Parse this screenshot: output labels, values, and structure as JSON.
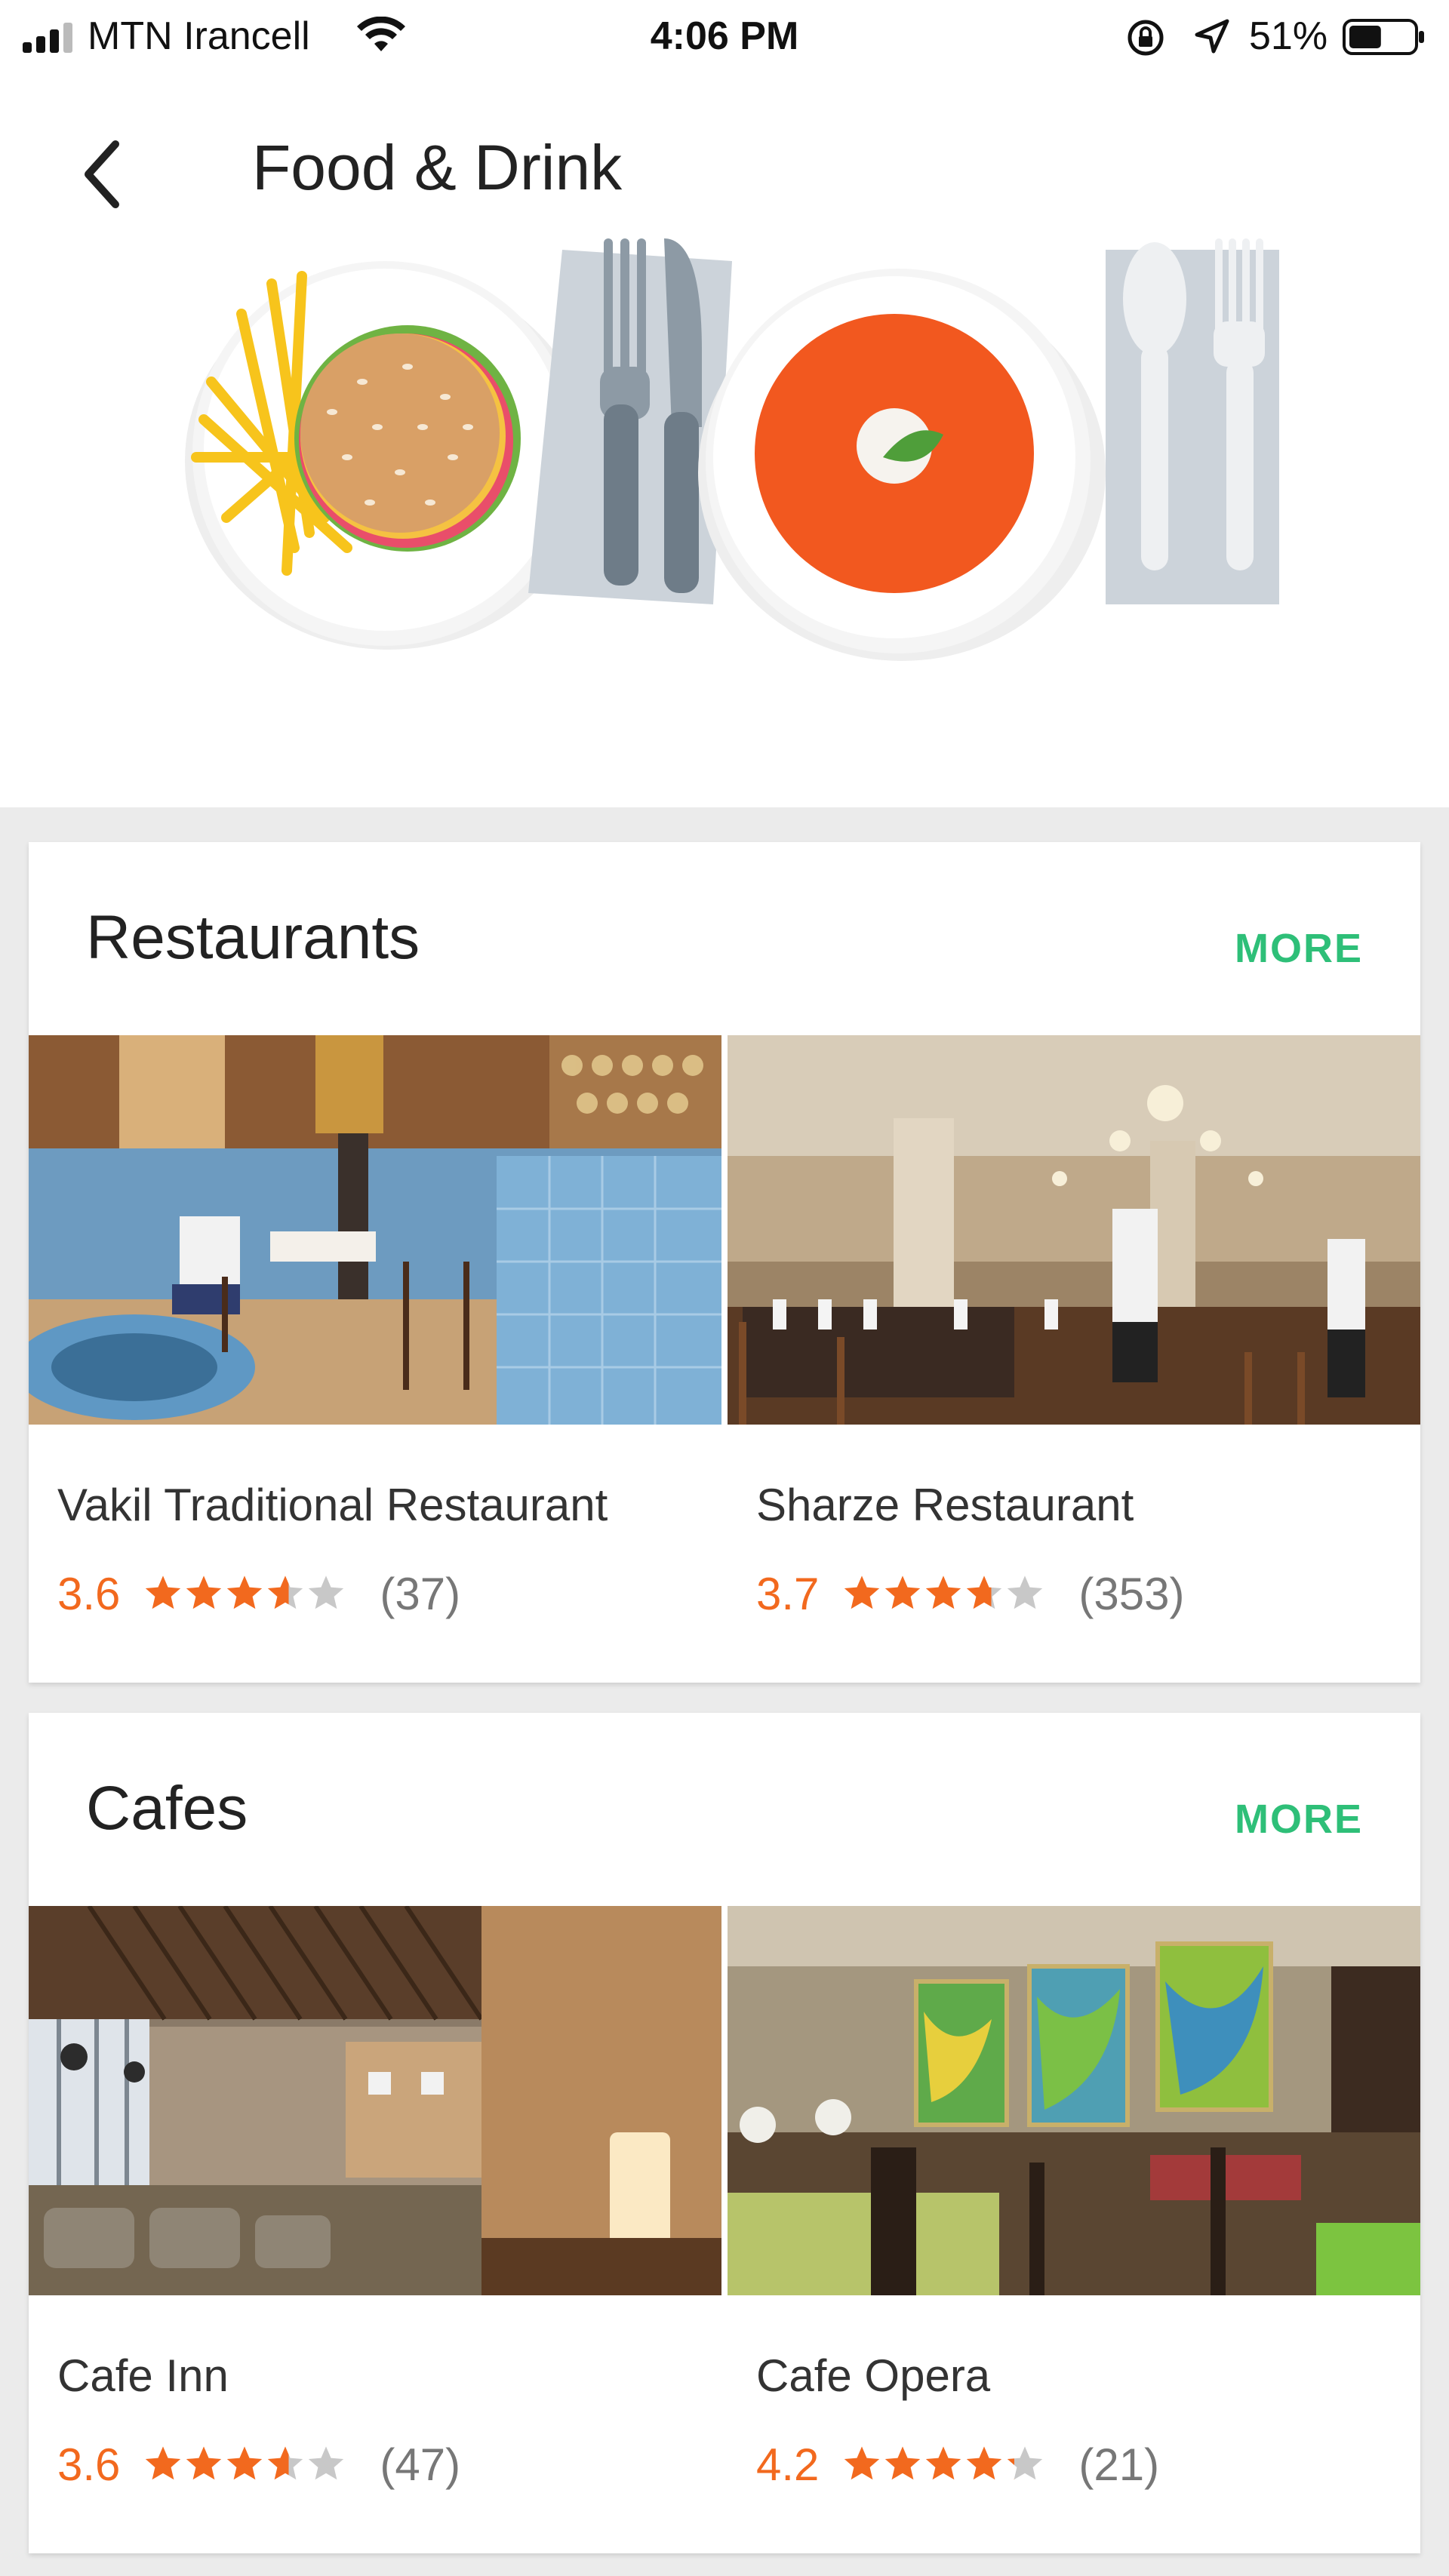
{
  "status_bar": {
    "carrier": "MTN Irancell",
    "time": "4:06 PM",
    "battery_percent": "51%",
    "battery_level": 0.51
  },
  "header": {
    "title": "Food & Drink",
    "back_icon": "chevron-left-icon"
  },
  "sections": [
    {
      "title": "Restaurants",
      "more_label": "MORE",
      "places": [
        {
          "name": "Vakil Traditional Restaurant",
          "rating": "3.6",
          "stars": 3.6,
          "reviews": "(37)"
        },
        {
          "name": "Sharze Restaurant",
          "rating": "3.7",
          "stars": 3.7,
          "reviews": "(353)"
        }
      ]
    },
    {
      "title": "Cafes",
      "more_label": "MORE",
      "places": [
        {
          "name": "Cafe Inn",
          "rating": "3.6",
          "stars": 3.6,
          "reviews": "(47)"
        },
        {
          "name": "Cafe Opera",
          "rating": "4.2",
          "stars": 4.2,
          "reviews": "(21)"
        }
      ]
    }
  ],
  "colors": {
    "accent_green": "#2ebf78",
    "rating_orange": "#f2691e",
    "star_empty": "#c8c8c8"
  }
}
